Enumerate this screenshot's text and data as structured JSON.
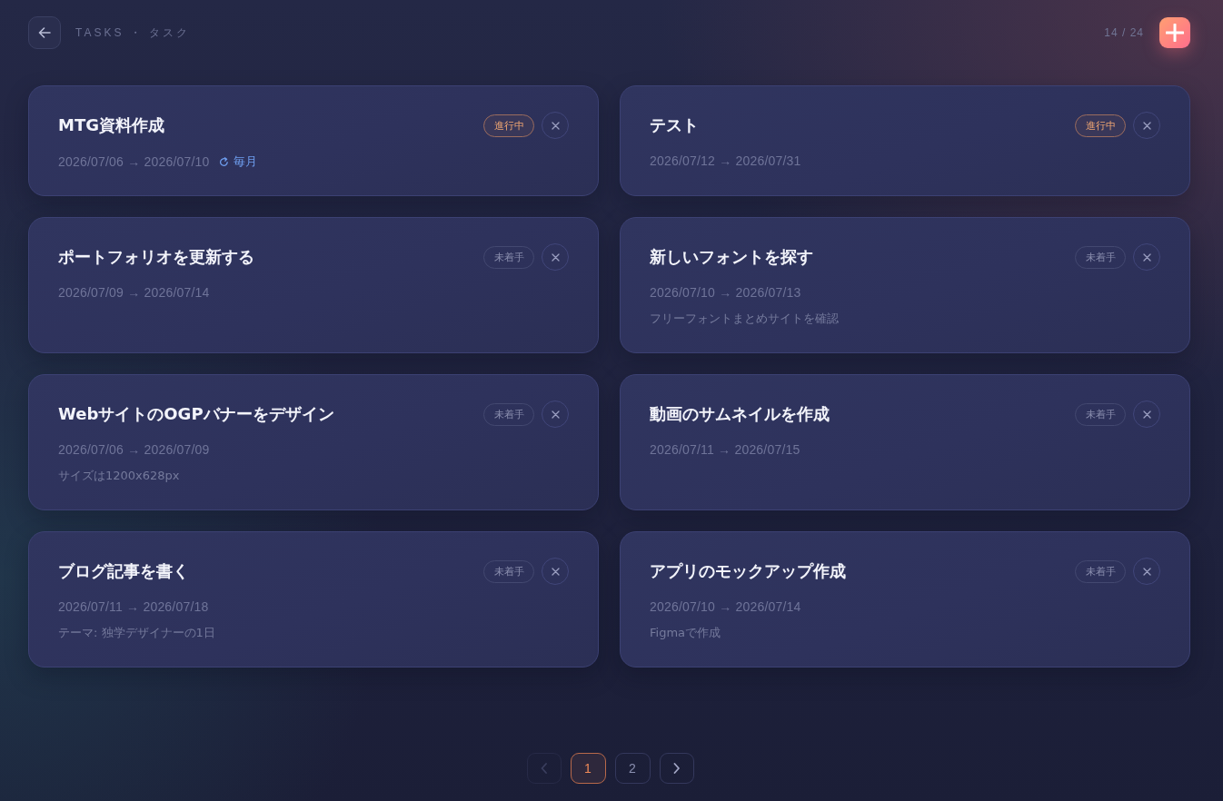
{
  "header": {
    "title": "TASKS ・ タスク",
    "count": "14 / 24"
  },
  "tasks": [
    {
      "title": "MTG資料作成",
      "dates": "2026/07/06 → 2026/07/10",
      "repeat": "毎月",
      "badge": {
        "kind": "in_progress",
        "label": "進行中"
      }
    },
    {
      "title": "テスト",
      "dates": "2026/07/12 → 2026/07/31",
      "badge": {
        "kind": "in_progress",
        "label": "進行中"
      }
    },
    {
      "title": "ポートフォリオを更新する",
      "dates": "2026/07/09 → 2026/07/14",
      "badge": {
        "kind": "not_started",
        "label": "未着手"
      }
    },
    {
      "title": "新しいフォントを探す",
      "dates": "2026/07/10 → 2026/07/13",
      "note": "フリーフォントまとめサイトを確認",
      "badge": {
        "kind": "not_started",
        "label": "未着手"
      }
    },
    {
      "title": "WebサイトのOGPバナーをデザイン",
      "dates": "2026/07/06 → 2026/07/09",
      "note": "サイズは1200x628px",
      "badge": {
        "kind": "not_started",
        "label": "未着手"
      }
    },
    {
      "title": "動画のサムネイルを作成",
      "dates": "2026/07/11 → 2026/07/15",
      "badge": {
        "kind": "not_started",
        "label": "未着手"
      }
    },
    {
      "title": "ブログ記事を書く",
      "dates": "2026/07/11 → 2026/07/18",
      "note": "テーマ: 独学デザイナーの1日",
      "badge": {
        "kind": "not_started",
        "label": "未着手"
      }
    },
    {
      "title": "アプリのモックアップ作成",
      "dates": "2026/07/10 → 2026/07/14",
      "note": "Figmaで作成",
      "badge": {
        "kind": "not_started",
        "label": "未着手"
      }
    }
  ],
  "pagination": {
    "previous": {
      "disabled": true
    },
    "pages": [
      {
        "label": "1",
        "selected": true
      },
      {
        "label": "2",
        "selected": false
      }
    ],
    "next": {
      "disabled": false
    }
  }
}
